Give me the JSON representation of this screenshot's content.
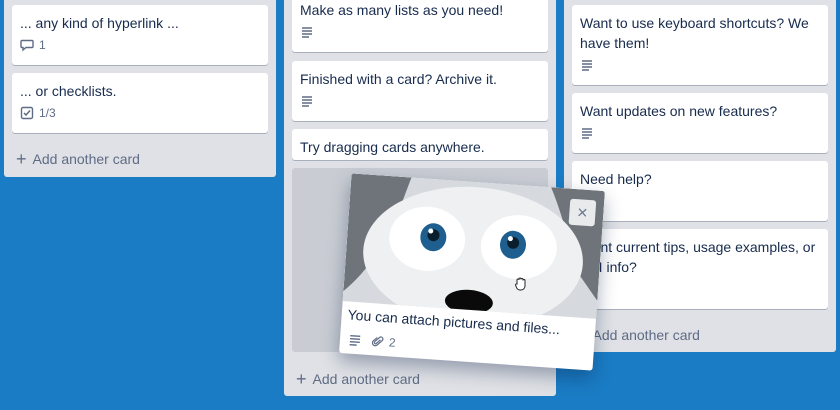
{
  "lists": {
    "left": {
      "cards": [
        {
          "title": "... any kind of hyperlink ...",
          "badge_icon": "comment-icon",
          "badge_text": "1"
        },
        {
          "title": "... or checklists.",
          "badge_icon": "checklist-icon",
          "badge_text": "1/3"
        }
      ],
      "add_card": "Add another card"
    },
    "middle": {
      "cards": [
        {
          "title": "Make as many lists as you need!",
          "badge_icon": "description-icon"
        },
        {
          "title": "Finished with a card? Archive it.",
          "badge_icon": "description-icon"
        },
        {
          "title": "Try dragging cards anywhere."
        }
      ],
      "add_card": "Add another card"
    },
    "right": {
      "cards": [
        {
          "title": "Want to use keyboard shortcuts? We have them!",
          "badge_icon": "description-icon"
        },
        {
          "title": "Want updates on new features?",
          "badge_icon": "description-icon"
        },
        {
          "title": "Need help?"
        },
        {
          "title": "Want current tips, usage examples, or API info?"
        }
      ],
      "add_card": "Add another card"
    }
  },
  "dragged_card": {
    "title": "You can attach pictures and files...",
    "attachments": "2",
    "close": "×",
    "cover_image": "husky-dog-face"
  },
  "colors": {
    "board_background": "#1a7cc4",
    "list_background": "#dfe1e6",
    "card_background": "#ffffff",
    "text": "#172b4d",
    "muted": "#5e6c84"
  }
}
